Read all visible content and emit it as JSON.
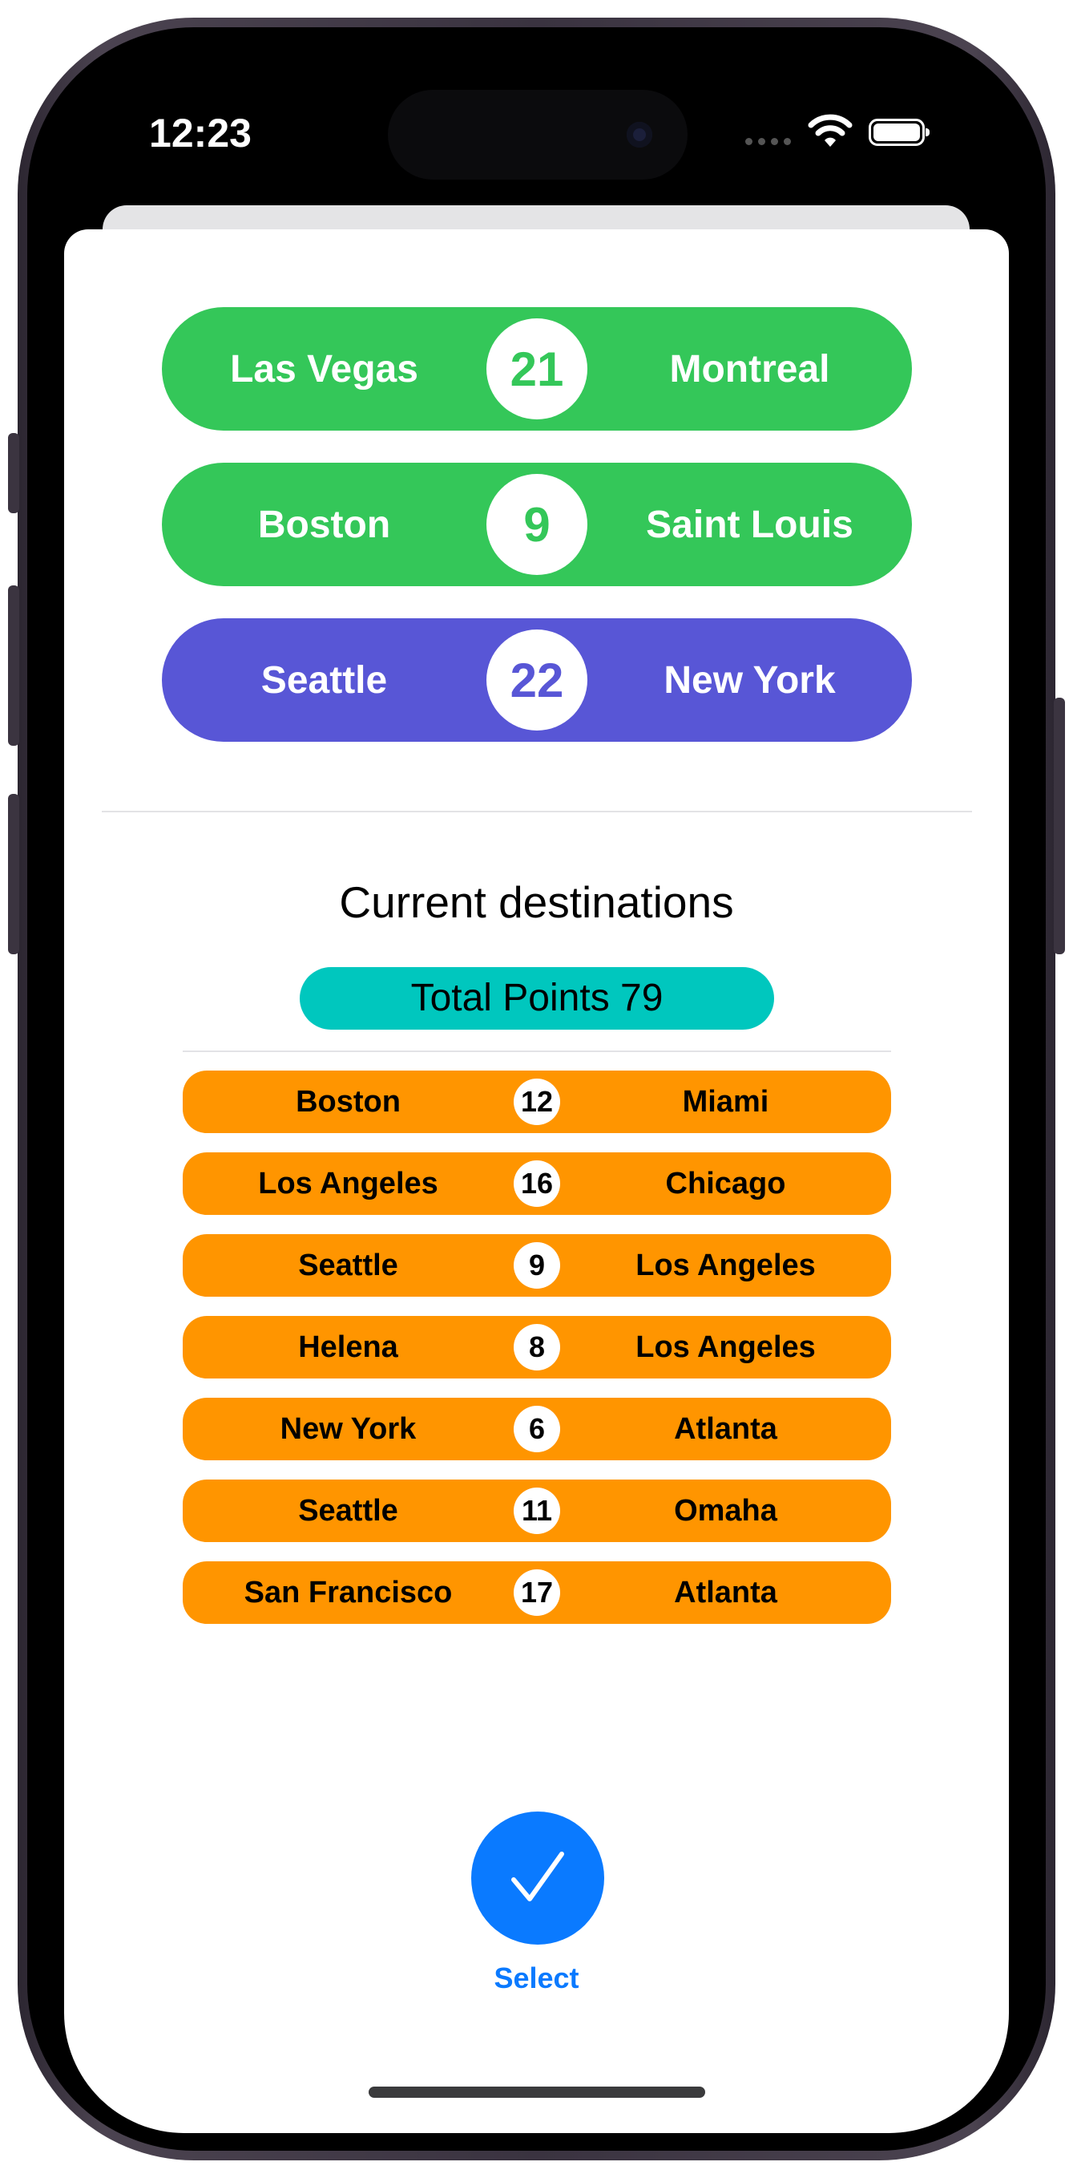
{
  "status_bar": {
    "time": "12:23"
  },
  "colors": {
    "green": "#34c759",
    "indigo": "#5856d6",
    "orange": "#ff9500",
    "teal": "#00c7be",
    "blue": "#0a7aff"
  },
  "route_options": [
    {
      "from": "Las Vegas",
      "points": "21",
      "to": "Montreal",
      "color": "#34c759",
      "points_color": "#34c759"
    },
    {
      "from": "Boston",
      "points": "9",
      "to": "Saint Louis",
      "color": "#34c759",
      "points_color": "#34c759"
    },
    {
      "from": "Seattle",
      "points": "22",
      "to": "New York",
      "color": "#5856d6",
      "points_color": "#5856d6"
    }
  ],
  "current": {
    "title": "Current destinations",
    "total_label": "Total Points 79",
    "destinations": [
      {
        "from": "Boston",
        "points": "12",
        "to": "Miami"
      },
      {
        "from": "Los Angeles",
        "points": "16",
        "to": "Chicago"
      },
      {
        "from": "Seattle",
        "points": "9",
        "to": "Los Angeles"
      },
      {
        "from": "Helena",
        "points": "8",
        "to": "Los Angeles"
      },
      {
        "from": "New York",
        "points": "6",
        "to": "Atlanta"
      },
      {
        "from": "Seattle",
        "points": "11",
        "to": "Omaha"
      },
      {
        "from": "San Francisco",
        "points": "17",
        "to": "Atlanta"
      }
    ]
  },
  "select_button": {
    "label": "Select",
    "icon": "checkmark-icon"
  }
}
